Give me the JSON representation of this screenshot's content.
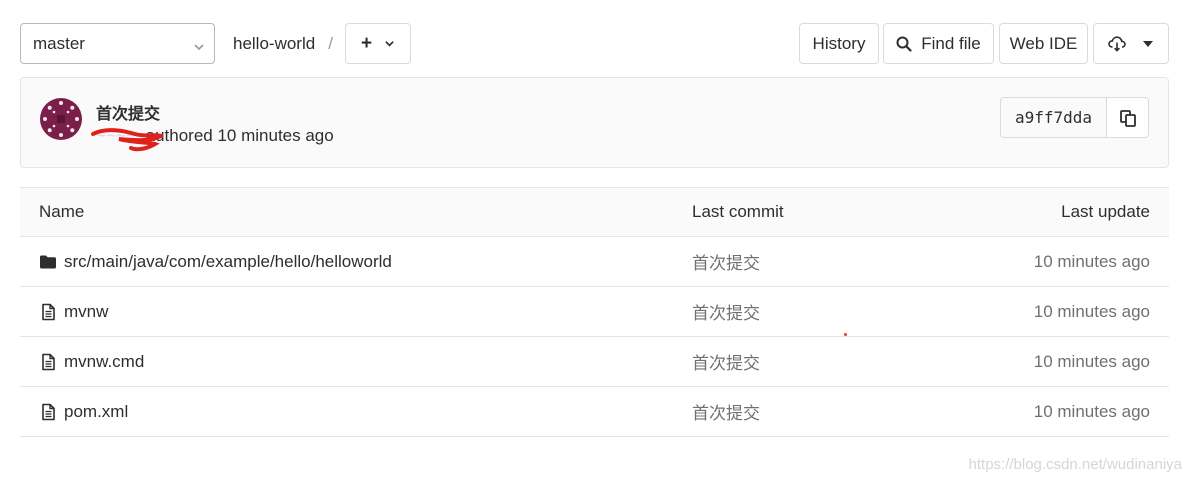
{
  "toolbar": {
    "branch": "master",
    "project": "hello-world",
    "separator": "/",
    "add_label": "+",
    "history_label": "History",
    "find_file_label": "Find file",
    "web_ide_label": "Web IDE"
  },
  "commit": {
    "title": "首次提交",
    "author": "~~~~~",
    "authored_text": "authored 10 minutes ago",
    "sha": "a9ff7dda"
  },
  "table": {
    "headers": {
      "name": "Name",
      "last_commit": "Last commit",
      "last_update": "Last update"
    },
    "rows": [
      {
        "type": "folder",
        "name": "src/main/java/com/example/hello/helloworld",
        "commit": "首次提交",
        "updated": "10 minutes ago"
      },
      {
        "type": "file",
        "name": "mvnw",
        "commit": "首次提交",
        "updated": "10 minutes ago"
      },
      {
        "type": "file",
        "name": "mvnw.cmd",
        "commit": "首次提交",
        "updated": "10 minutes ago"
      },
      {
        "type": "file",
        "name": "pom.xml",
        "commit": "首次提交",
        "updated": "10 minutes ago"
      }
    ]
  },
  "watermark": "https://blog.csdn.net/wudinaniya",
  "colors": {
    "avatar": "#7a1f4a",
    "border": "#dbdbdb",
    "scribble": "#e0201b"
  }
}
